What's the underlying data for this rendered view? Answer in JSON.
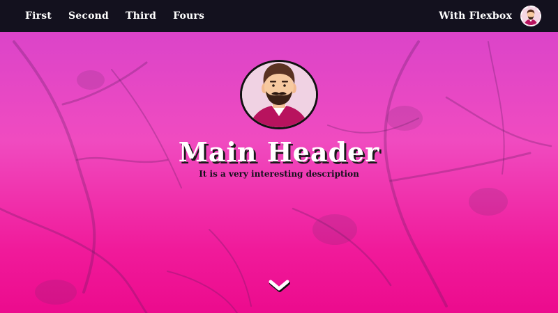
{
  "nav": {
    "links": [
      "First",
      "Second",
      "Third",
      "Fours"
    ],
    "brand": "With Flexbox"
  },
  "hero": {
    "title": "Main Header",
    "subtitle": "It is a very interesting description"
  },
  "icons": {
    "scroll": "chevron-down-icon",
    "avatar": "bearded-man-avatar"
  },
  "colors": {
    "navbar": "#13111e",
    "gradient_top": "#d542cc",
    "gradient_bottom": "#ec0b8d",
    "title_text": "#ffffff",
    "subtitle_text": "#14101a"
  }
}
